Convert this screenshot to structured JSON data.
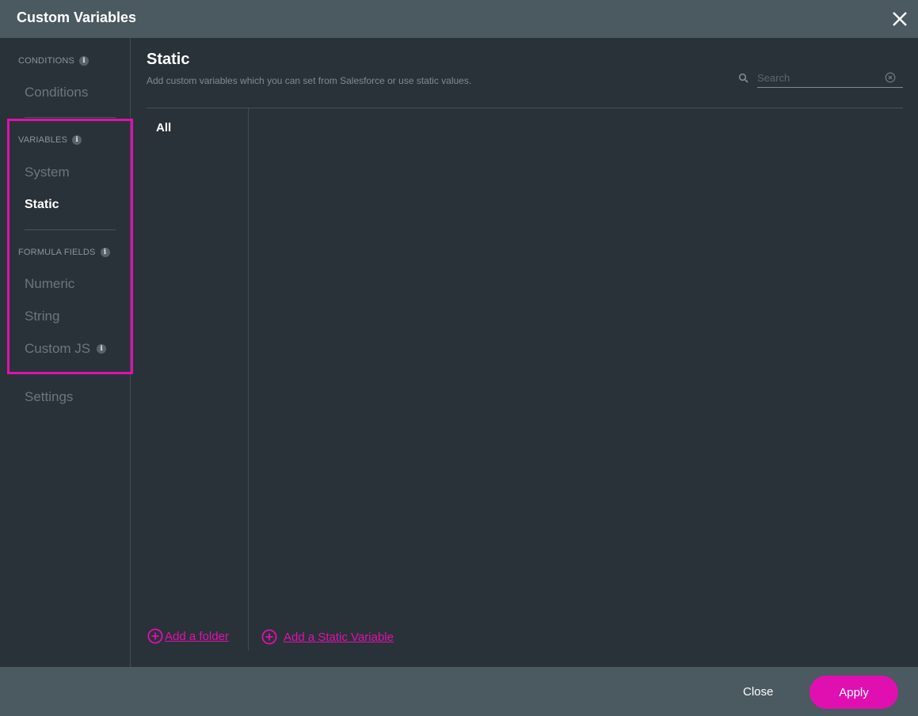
{
  "header": {
    "title": "Custom Variables",
    "close_icon": "close-x-icon"
  },
  "sidebar": {
    "sections": [
      {
        "label": "CONDITIONS",
        "has_info": true,
        "items": [
          {
            "label": "Conditions",
            "active": false
          }
        ]
      },
      {
        "label": "VARIABLES",
        "has_info": true,
        "items": [
          {
            "label": "System",
            "active": false
          },
          {
            "label": "Static",
            "active": true
          }
        ]
      },
      {
        "label": "FORMULA FIELDS",
        "has_info": true,
        "items": [
          {
            "label": "Numeric",
            "active": false
          },
          {
            "label": "String",
            "active": false
          },
          {
            "label": "Custom JS",
            "active": false,
            "has_info": true
          }
        ]
      }
    ],
    "settings_label": "Settings",
    "info_glyph": "i"
  },
  "main": {
    "title": "Static",
    "subtitle": "Add custom variables which you can set from Salesforce or use static values.",
    "search": {
      "placeholder": "Search",
      "value": ""
    },
    "folders": [
      "All"
    ],
    "add_folder_label": "Add a folder",
    "add_variable_label": "Add a Static Variable"
  },
  "footer": {
    "close_label": "Close",
    "apply_label": "Apply"
  },
  "colors": {
    "accent": "#e010b0",
    "header_bg": "#4b5960",
    "body_bg": "#293238"
  }
}
